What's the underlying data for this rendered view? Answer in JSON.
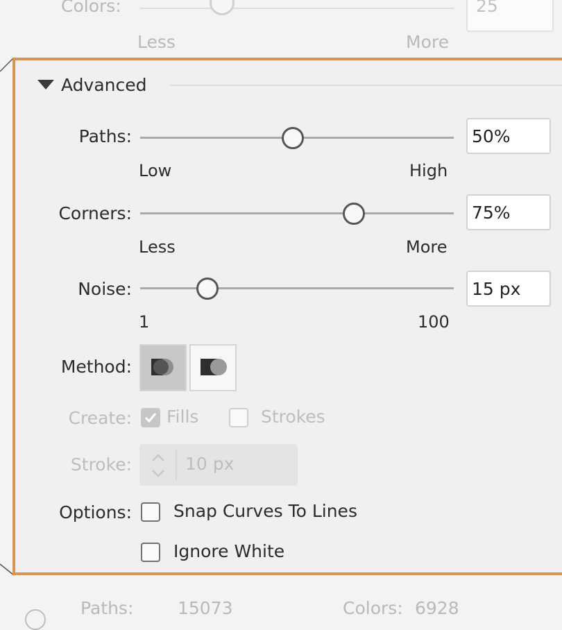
{
  "top": {
    "label": "Colors:",
    "range_low": "Less",
    "range_high": "More",
    "value": "25"
  },
  "advanced": {
    "header": "Advanced",
    "paths": {
      "label": "Paths:",
      "low": "Low",
      "high": "High",
      "value": "50%",
      "level": 0.5
    },
    "corners": {
      "label": "Corners:",
      "low": "Less",
      "high": "More",
      "value": "75%",
      "level": 0.75
    },
    "noise": {
      "label": "Noise:",
      "low": "1",
      "high": "100",
      "value": "15 px",
      "level": 0.15
    },
    "method": {
      "label": "Method:"
    },
    "create": {
      "label": "Create:",
      "fills": "Fills",
      "strokes": "Strokes"
    },
    "stroke": {
      "label": "Stroke:",
      "value": "10 px"
    },
    "options": {
      "label": "Options:",
      "snap": "Snap Curves To Lines",
      "ignore_white": "Ignore White"
    }
  },
  "footer": {
    "paths_label": "Paths:",
    "paths_value": "15073",
    "colors_label": "Colors:",
    "colors_value": "6928"
  },
  "colors": {
    "highlight": "#d99453",
    "panel_bg": "#f0f0f0"
  }
}
